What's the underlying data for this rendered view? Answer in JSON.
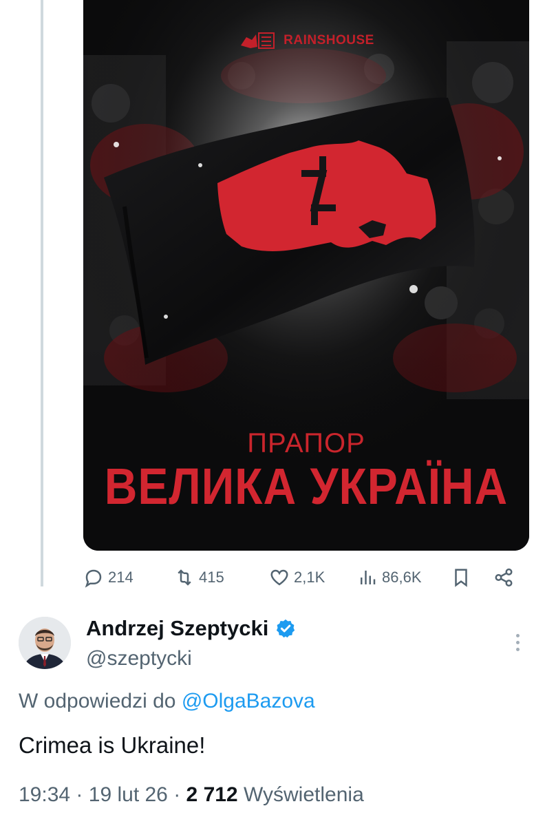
{
  "media": {
    "brand_text": "RAINSHOUSE",
    "poster_subtitle": "ПРАПОР",
    "poster_title": "ВЕЛИКА УКРАЇНА",
    "accent_color": "#d22630"
  },
  "actions": {
    "replies": "214",
    "reposts": "415",
    "likes": "2,1K",
    "views": "86,6K"
  },
  "reply_tweet": {
    "name": "Andrzej Szeptycki",
    "handle": "@szeptycki",
    "replying_prefix": "W odpowiedzi do",
    "replying_to": "@OlgaBazova",
    "text": "Crimea is Ukraine!",
    "time": "19:34",
    "date": "19 lut 26",
    "views_count": "2 712",
    "views_label": "Wyświetlenia",
    "verified_color": "#1d9bf0"
  }
}
